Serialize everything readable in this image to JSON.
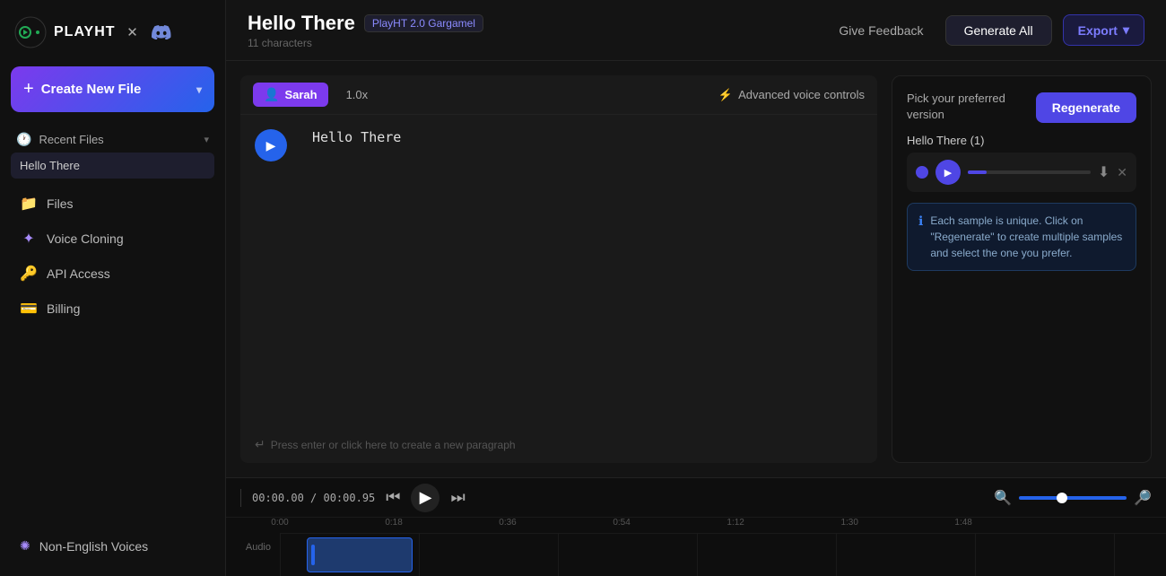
{
  "app": {
    "logo_text": "PLAYHT",
    "logo_symbol": "▶"
  },
  "sidebar": {
    "create_button_label": "Create New File",
    "create_button_plus": "+",
    "recent_files_label": "Recent Files",
    "recent_files_chevron": "▾",
    "clock_icon": "🕐",
    "files": [
      {
        "name": "Hello There"
      }
    ],
    "nav_items": [
      {
        "id": "files",
        "label": "Files",
        "icon": "📁"
      },
      {
        "id": "voice-cloning",
        "label": "Voice Cloning",
        "icon": "✦"
      },
      {
        "id": "api-access",
        "label": "API Access",
        "icon": "🔑"
      },
      {
        "id": "billing",
        "label": "Billing",
        "icon": "💳"
      }
    ],
    "non_english": {
      "label": "Non-English Voices",
      "icon": "✺"
    }
  },
  "topbar": {
    "title": "Hello There",
    "badge": "PlayHT 2.0 Gargamel",
    "subtitle": "11 characters",
    "feedback_label": "Give Feedback",
    "generate_label": "Generate All",
    "export_label": "Export",
    "export_chevron": "▾"
  },
  "editor": {
    "voice_name": "Sarah",
    "speed": "1.0x",
    "advanced_controls": "Advanced voice controls",
    "filter_icon": "⚡",
    "text_content": "Hello There",
    "paragraph_hint": "Press enter or click here to create a new paragraph",
    "return_icon": "↵"
  },
  "right_panel": {
    "pick_version_title": "Pick your preferred version",
    "regenerate_label": "Regenerate",
    "version_label": "Hello There (1)",
    "info_text": "Each sample is unique. Click on \"Regenerate\" to create multiple samples and select the one you prefer."
  },
  "timeline": {
    "time_current": "00:00.00",
    "time_separator": "/",
    "time_total": "00:00.95",
    "ruler_marks": [
      "0:00",
      "0:18",
      "0:36",
      "0:54",
      "1:12",
      "1:30",
      "1:48"
    ],
    "track_label": "Audio"
  }
}
